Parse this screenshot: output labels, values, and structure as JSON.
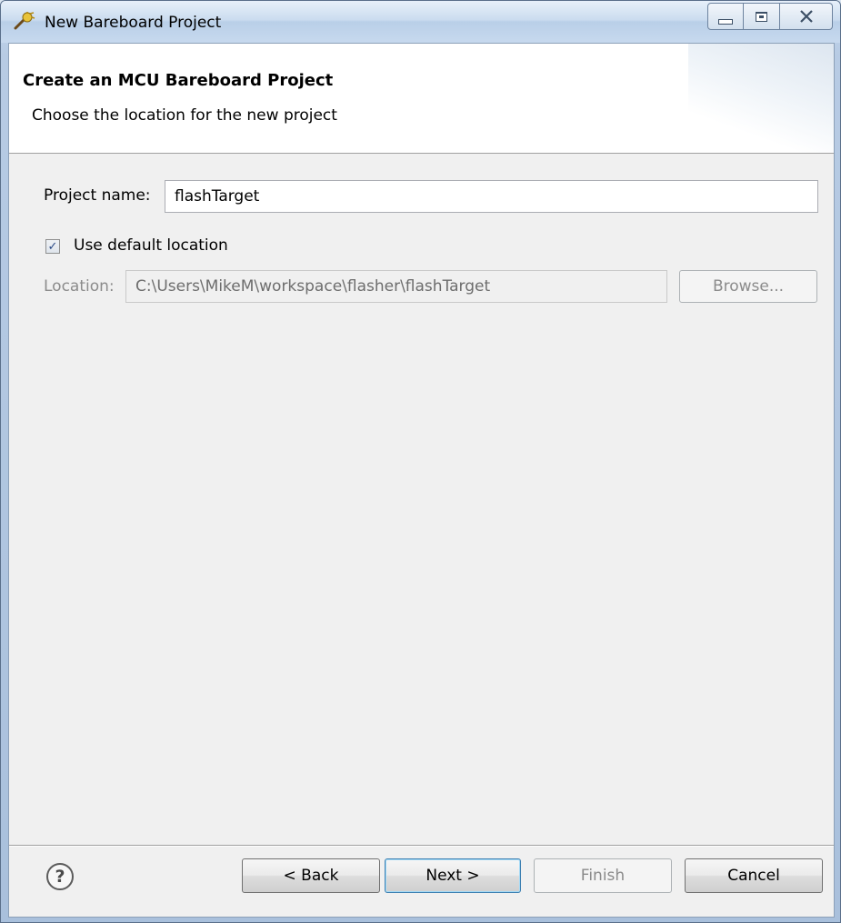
{
  "window": {
    "title": "New Bareboard Project",
    "app_icon": "wizard-wand-icon"
  },
  "banner": {
    "title": "Create an MCU Bareboard Project",
    "description": "Choose the location for the new project"
  },
  "form": {
    "project_name_label": "Project name:",
    "project_name_value": "flashTarget",
    "use_default_location_label": "Use default location",
    "use_default_location_checked": true,
    "location_label": "Location:",
    "location_value": "C:\\Users\\MikeM\\workspace\\flasher\\flashTarget",
    "browse_label": "Browse..."
  },
  "footer": {
    "help_icon": "help-icon",
    "help_glyph": "?",
    "back_label": "< Back",
    "next_label": "Next >",
    "finish_label": "Finish",
    "cancel_label": "Cancel"
  },
  "colors": {
    "banner_bg": "#ffffff",
    "dialog_bg": "#f0f0f0",
    "default_button_border": "#3c7fb1"
  }
}
